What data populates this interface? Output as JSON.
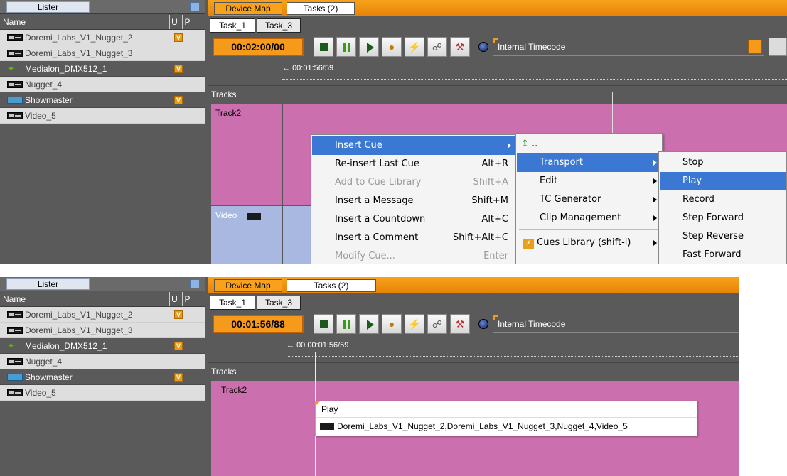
{
  "top": {
    "lister": {
      "title": "Lister",
      "col_name": "Name",
      "col_u": "U",
      "col_p": "P",
      "items": [
        {
          "label": "Doremi_Labs_V1_Nugget_2",
          "badge": "V"
        },
        {
          "label": "Doremi_Labs_V1_Nugget_3",
          "badge": ""
        },
        {
          "label": "Medialon_DMX512_1",
          "badge": "V"
        },
        {
          "label": "Nugget_4",
          "badge": ""
        },
        {
          "label": "Showmaster",
          "badge": "V"
        },
        {
          "label": "Video_5",
          "badge": ""
        }
      ]
    },
    "tabs": {
      "device_map": "Device Map",
      "tasks": "Tasks (2)"
    },
    "task_tabs": [
      "Task_1",
      "Task_3"
    ],
    "timecode": "00:02:00/00",
    "timecode_source": "Internal Timecode",
    "ruler_label": "00:01:56/59",
    "tracks_label": "Tracks",
    "track2_label": "Track2",
    "video_label": "Video",
    "context_menu": [
      {
        "label": "Insert Cue",
        "shortcut": ""
      },
      {
        "label": "Re-insert Last Cue",
        "shortcut": "Alt+R"
      },
      {
        "label": "Add to Cue Library",
        "shortcut": "Shift+A"
      },
      {
        "label": "Insert a Message",
        "shortcut": "Shift+M"
      },
      {
        "label": "Insert a Countdown",
        "shortcut": "Alt+C"
      },
      {
        "label": "Insert a Comment",
        "shortcut": "Shift+Alt+C"
      },
      {
        "label": "Modify Cue...",
        "shortcut": "Enter"
      }
    ],
    "submenu_insert_cue": {
      "up": "..",
      "items": [
        "Transport",
        "Edit",
        "TC Generator",
        "Clip Management"
      ],
      "library": "Cues Library (shift-i)"
    },
    "submenu_transport": [
      "Stop",
      "Play",
      "Record",
      "Step Forward",
      "Step Reverse",
      "Fast Forward"
    ]
  },
  "bottom": {
    "lister": {
      "title": "Lister",
      "col_name": "Name",
      "col_u": "U",
      "col_p": "P",
      "items": [
        {
          "label": "Doremi_Labs_V1_Nugget_2",
          "badge": "V"
        },
        {
          "label": "Doremi_Labs_V1_Nugget_3",
          "badge": ""
        },
        {
          "label": "Medialon_DMX512_1",
          "badge": "V"
        },
        {
          "label": "Nugget_4",
          "badge": ""
        },
        {
          "label": "Showmaster",
          "badge": "V"
        },
        {
          "label": "Video_5",
          "badge": ""
        }
      ]
    },
    "tabs": {
      "device_map": "Device Map",
      "tasks": "Tasks (2)"
    },
    "task_tabs": [
      "Task_1",
      "Task_3"
    ],
    "timecode": "00:01:56/88",
    "timecode_source": "Internal Timecode",
    "ruler_label": "00:01:56/59",
    "ruler_prefix": "00",
    "tracks_label": "Tracks",
    "track2_label": "Track2",
    "cue_title": "Play",
    "cue_targets": "Doremi_Labs_V1_Nugget_2,Doremi_Labs_V1_Nugget_3,Nugget_4,Video_5"
  }
}
